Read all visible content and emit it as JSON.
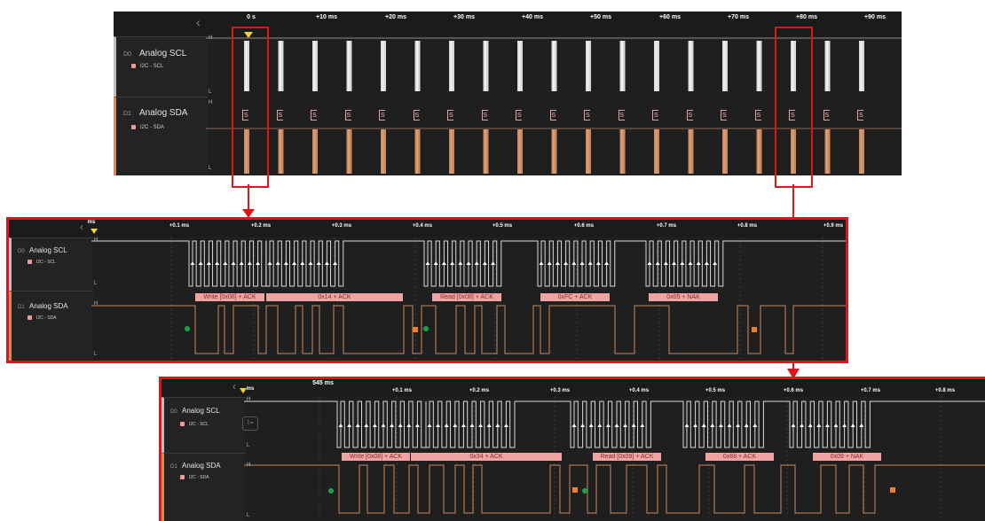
{
  "panels": [
    {
      "id": "overview",
      "collapse_glyph": "‹",
      "ruler_ticks": [
        "0 s",
        "+10 ms",
        "+20 ms",
        "+30 ms",
        "+40 ms",
        "+50 ms",
        "+60 ms",
        "+70 ms",
        "+80 ms",
        "+90 ms"
      ],
      "channels": [
        {
          "num": "D0",
          "name": "Analog SCL",
          "analyzer": "I2C - SCL",
          "high_label": "H",
          "low_label": "L"
        },
        {
          "num": "D1",
          "name": "Analog SDA",
          "analyzer": "I2C - SDA",
          "high_label": "H",
          "low_label": "L"
        }
      ],
      "start_label": "S"
    },
    {
      "id": "zoom-1",
      "collapse_glyph": "‹",
      "ruler_ticks": [
        "ms",
        "+0.1 ms",
        "+0.2 ms",
        "+0.3 ms",
        "+0.4 ms",
        "+0.5 ms",
        "+0.6 ms",
        "+0.7 ms",
        "+0.8 ms",
        "+0.9 ms"
      ],
      "channels": [
        {
          "num": "D0",
          "name": "Analog SCL",
          "analyzer": "I2C - SCL",
          "high_label": "H",
          "low_label": "L"
        },
        {
          "num": "D1",
          "name": "Analog SDA",
          "analyzer": "I2C - SDA",
          "high_label": "H",
          "low_label": "L"
        }
      ],
      "decoded": [
        "Write [0x08] + ACK",
        "0x14 + ACK",
        "Read [0x08] + ACK",
        "0xFC + ACK",
        "0x05 + NAK"
      ]
    },
    {
      "id": "zoom-2",
      "collapse_glyph": "‹",
      "cursor_time": "545 ms",
      "ruler_ticks": [
        "ms",
        "+0.1 ms",
        "+0.2 ms",
        "+0.3 ms",
        "+0.4 ms",
        "+0.5 ms",
        "+0.6 ms",
        "+0.7 ms",
        "+0.8 ms"
      ],
      "channels": [
        {
          "num": "D0",
          "name": "Analog SCL",
          "analyzer": "I2C - SCL",
          "high_label": "H",
          "low_label": "L"
        },
        {
          "num": "D1",
          "name": "Analog SDA",
          "analyzer": "I2C - SDA",
          "high_label": "H",
          "low_label": "L"
        }
      ],
      "decoded": [
        "Write [0x08] + ACK",
        "0x34 + ACK",
        "Read [0x09] + ACK",
        "0x88 + ACK",
        "0x09 + NAK"
      ]
    }
  ],
  "colors": {
    "scl": "#d9d9d9",
    "sda": "#c98a5f",
    "highlight": "#e0151a",
    "decode_bar": "#f0a3a3"
  },
  "icons": {
    "collapse": "chevron-left-icon",
    "cursor": "time-cursor-marker-icon",
    "start": "start-condition-dot-icon",
    "stop": "stop-condition-square-icon",
    "callout": "zoom-callout-arrow-icon"
  }
}
